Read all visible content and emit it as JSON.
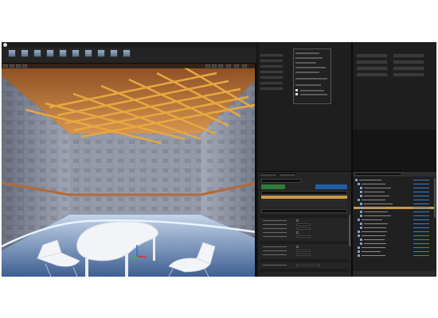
{
  "window": {
    "title": ""
  },
  "toolbar": {
    "buttons": [
      {
        "icon": "save-icon"
      },
      {
        "icon": "source-control-icon"
      },
      {
        "icon": "content-icon"
      },
      {
        "icon": "marketplace-icon"
      },
      {
        "icon": "settings-icon"
      },
      {
        "icon": "blueprints-icon"
      },
      {
        "icon": "cinematics-icon"
      },
      {
        "icon": "build-icon"
      },
      {
        "icon": "play-icon"
      },
      {
        "icon": "launch-icon"
      }
    ]
  },
  "viewport": {
    "colors": {
      "wall": "#8d93a3",
      "floor": "#9fb6d4",
      "ceiling": "#c07a3c",
      "beam": "#e8a840",
      "glow": "#e7f3ff",
      "furniture": "#f2f4f7"
    }
  },
  "modes": {
    "buttons": 7,
    "menu_lines": 9
  },
  "details": {
    "rows": 8
  },
  "outliner": {
    "rows": 20,
    "selected_index": 7,
    "colors": {
      "selection": "#c99a48",
      "type_link": "#3d7cc9"
    }
  },
  "right_top": {
    "buttons": 8
  }
}
